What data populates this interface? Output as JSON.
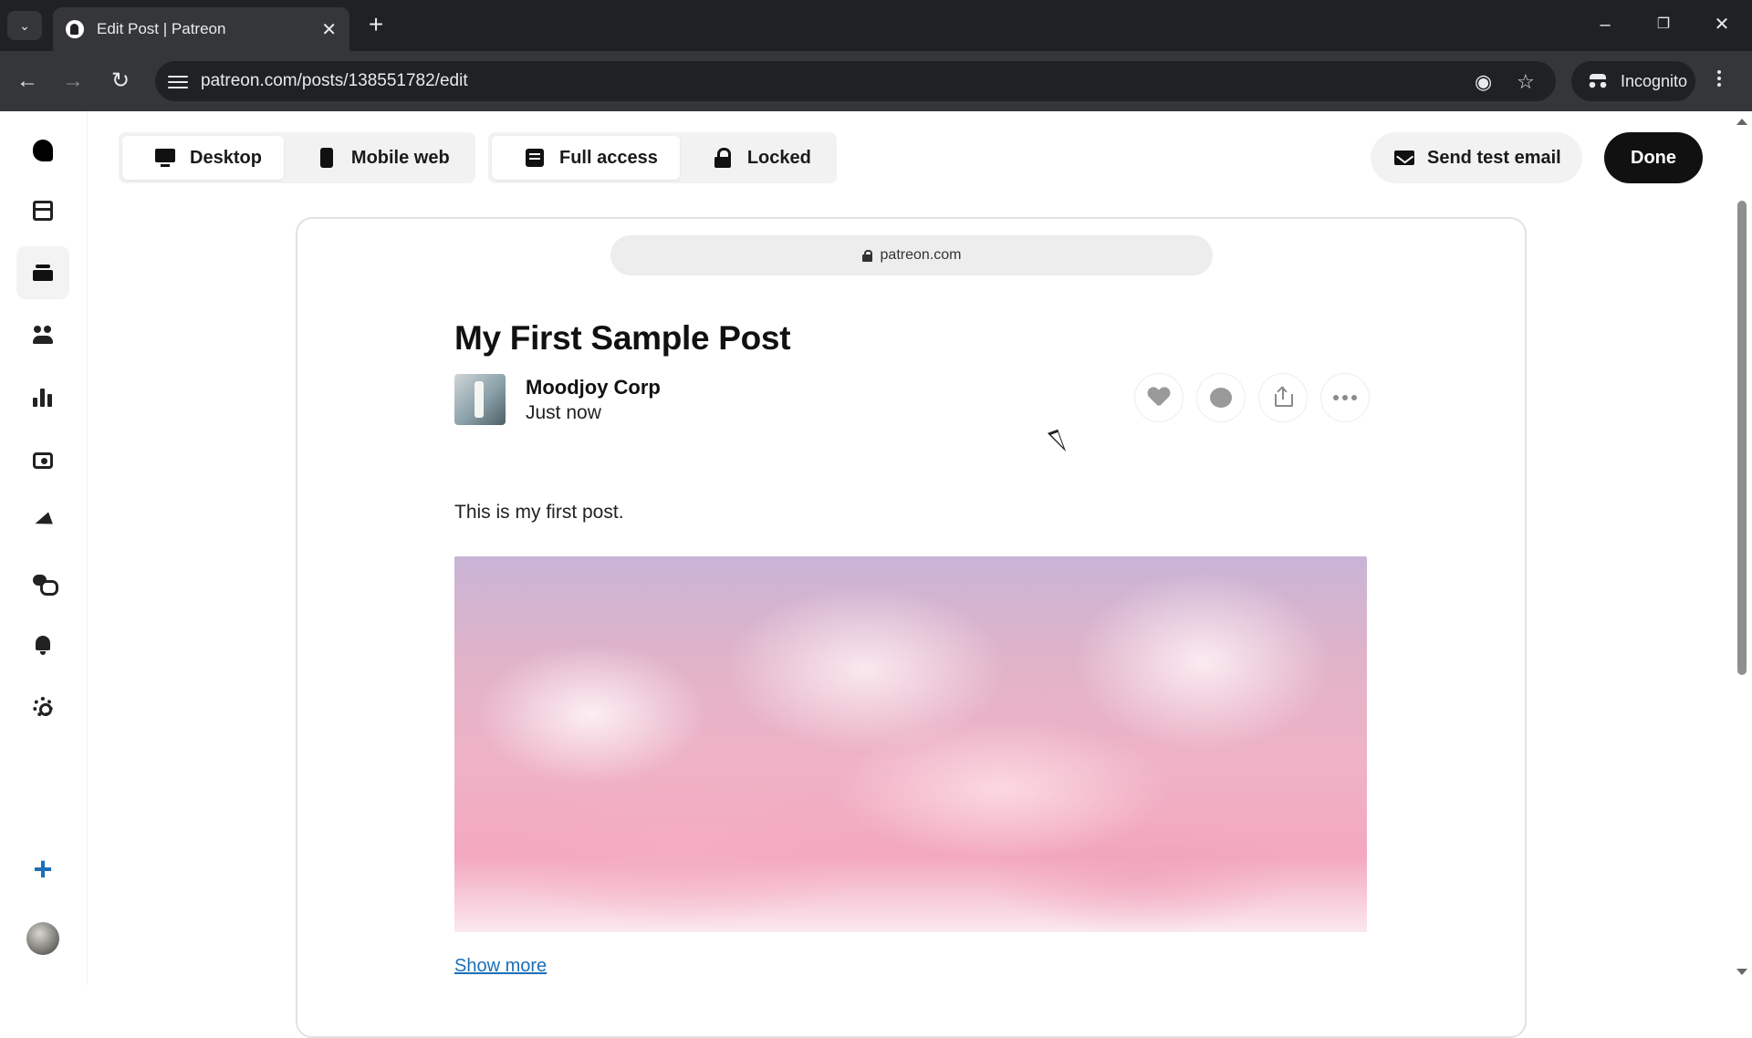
{
  "browser": {
    "tab_title": "Edit Post | Patreon",
    "url": "patreon.com/posts/138551782/edit",
    "incognito_label": "Incognito"
  },
  "sidebar": {
    "items": [
      {
        "icon": "patreon-logo-icon"
      },
      {
        "icon": "dashboard-icon"
      },
      {
        "icon": "library-icon",
        "active": true
      },
      {
        "icon": "audience-icon"
      },
      {
        "icon": "insights-icon"
      },
      {
        "icon": "payouts-icon"
      },
      {
        "icon": "promotions-icon"
      },
      {
        "icon": "chats-icon"
      },
      {
        "icon": "notifications-icon"
      },
      {
        "icon": "settings-icon"
      },
      {
        "icon": "create-plus-icon"
      },
      {
        "icon": "profile-avatar"
      }
    ]
  },
  "toolbar": {
    "view_options": [
      "Desktop",
      "Mobile web"
    ],
    "selected_view": "Desktop",
    "access_options": [
      "Full access",
      "Locked"
    ],
    "selected_access": "Full access",
    "send_test_email_label": "Send test email",
    "done_label": "Done"
  },
  "preview": {
    "domain": "patreon.com",
    "post": {
      "title": "My First Sample Post",
      "author": "Moodjoy Corp",
      "time": "Just now",
      "body": "This is my first post.",
      "image_description_icon": "pink-clouds-image",
      "show_more_label": "Show more"
    }
  },
  "colors": {
    "accent_link": "#1b6fb8",
    "done_button": "#111111",
    "chrome_dark": "#202124"
  }
}
